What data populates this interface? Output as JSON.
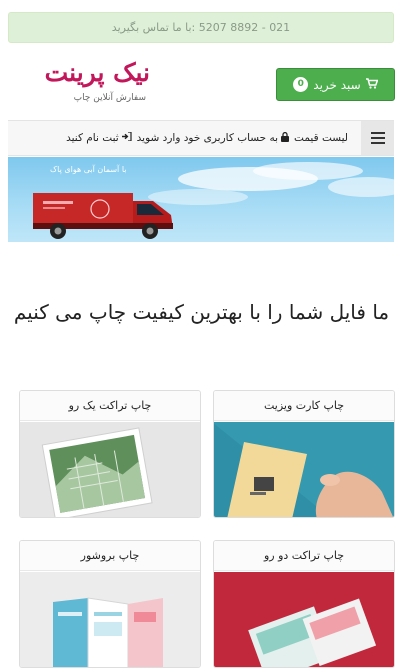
{
  "contact": {
    "text": "021 - 8892 5207 :با ما تماس بگیرید"
  },
  "logo": {
    "brand": "نیک پرینت",
    "tagline": "سفارش آنلاین چاپ"
  },
  "cart": {
    "label": "سبد خرید",
    "count": "0"
  },
  "nav": {
    "links": [
      {
        "label": "لیست قیمت"
      },
      {
        "label": "به حساب کاربری خود وارد شوید"
      },
      {
        "label": "ثبت نام کنید"
      }
    ]
  },
  "hero": {
    "caption": "با آسمان آبی هوای پاک"
  },
  "headline": "ما فایل شما را با بهترین کیفیت چاپ می کنیم",
  "products": [
    {
      "title": "چاپ کارت ویزیت"
    },
    {
      "title": "چاپ تراکت یک رو"
    },
    {
      "title": "چاپ تراکت دو رو"
    },
    {
      "title": "چاپ بروشور"
    }
  ]
}
